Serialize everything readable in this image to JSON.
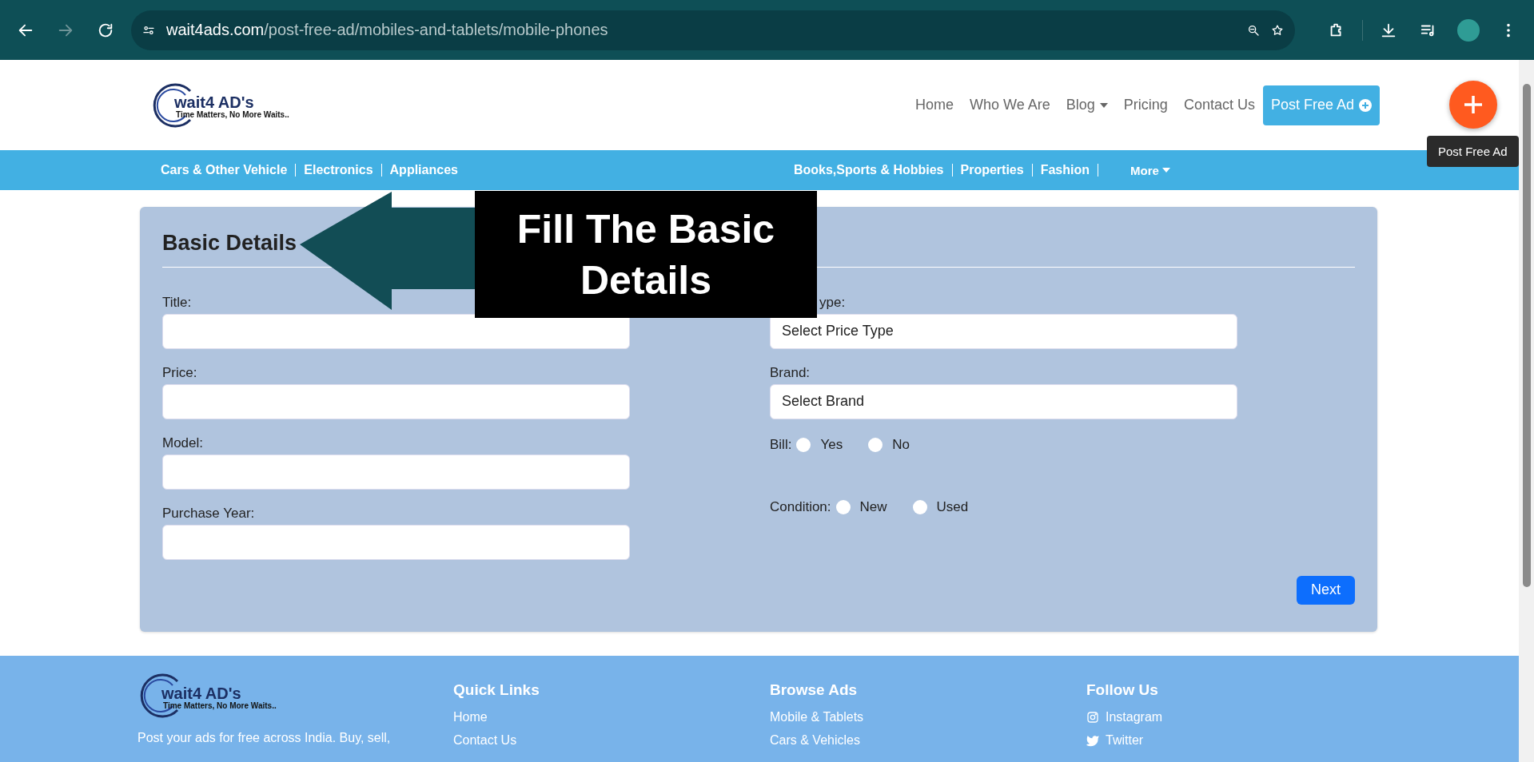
{
  "browser": {
    "url_host": "wait4ads.com",
    "url_path": "/post-free-ad/mobiles-and-tablets/mobile-phones"
  },
  "header": {
    "logo": {
      "name": "wait4 AD's",
      "tagline": "Time Matters, No More Waits.."
    },
    "nav": [
      {
        "label": "Home",
        "kind": "link"
      },
      {
        "label": "Who We Are",
        "kind": "link"
      },
      {
        "label": "Blog",
        "kind": "dropdown"
      },
      {
        "label": "Pricing",
        "kind": "link"
      },
      {
        "label": "Contact Us",
        "kind": "link"
      }
    ],
    "post_button": "Post Free Ad",
    "fab_tooltip": "Post Free Ad"
  },
  "categories": [
    {
      "label": "Cars & Other Vehicle",
      "kind": "link"
    },
    {
      "label": "Electronics",
      "kind": "link"
    },
    {
      "label": "Appliances",
      "kind": "link"
    },
    {
      "kind": "covered"
    },
    {
      "label": "Books,Sports & Hobbies",
      "kind": "link"
    },
    {
      "label": "Properties",
      "kind": "link"
    },
    {
      "label": "Fashion",
      "kind": "link"
    },
    {
      "label": "More",
      "kind": "dropdown"
    }
  ],
  "form": {
    "title": "Basic Details",
    "left": [
      {
        "label": "Title:"
      },
      {
        "label": "Price:"
      },
      {
        "label": "Model:"
      },
      {
        "label": "Purchase Year:"
      }
    ],
    "right": [
      {
        "kind": "select",
        "label": "ype:",
        "value": "Select Price Type",
        "label_covered": true
      },
      {
        "kind": "select",
        "label": "Brand:",
        "value": "Select Brand",
        "label_covered": false
      },
      {
        "kind": "radio",
        "label": "Bill:",
        "options": [
          {
            "label": "Yes",
            "selected": false
          },
          {
            "label": "No",
            "selected": false
          }
        ]
      },
      {
        "kind": "radio",
        "label": "Condition:",
        "options": [
          {
            "label": "New",
            "selected": false
          },
          {
            "label": "Used",
            "selected": false
          }
        ]
      }
    ],
    "next_button": "Next"
  },
  "callout": {
    "text": "Fill The Basic Details"
  },
  "footer": {
    "logo": {
      "name": "wait4 AD's",
      "tagline": "Time Matters, No More Waits.."
    },
    "about": "Post your ads for free across India. Buy, sell,",
    "columns": [
      {
        "title": "Quick Links",
        "kind": "links",
        "links": [
          "Home",
          "Contact Us"
        ]
      },
      {
        "title": "Browse Ads",
        "kind": "links",
        "links": [
          "Mobile & Tablets",
          "Cars & Vehicles"
        ]
      },
      {
        "title": "Follow Us",
        "kind": "social",
        "links": [
          "Instagram",
          "Twitter"
        ]
      }
    ]
  }
}
